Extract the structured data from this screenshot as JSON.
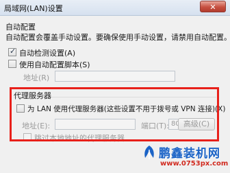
{
  "window": {
    "title": "局域网(LAN)设置",
    "close_label": "✕"
  },
  "auto_config": {
    "group_title": "自动配置",
    "description": "自动配置会覆盖手动设置。要确保使用手动设置，请禁用自动配置。",
    "auto_detect_label": "自动检测设置(A)",
    "auto_detect_checked": true,
    "use_script_label": "使用自动配置脚本(S)",
    "use_script_checked": false,
    "address_label": "地址(R)",
    "address_value": ""
  },
  "proxy": {
    "group_title": "代理服务器",
    "use_proxy_label": "为 LAN 使用代理服务器(这些设置不用于拨号或 VPN 连接)(X)",
    "use_proxy_checked": false,
    "address_label": "地址(E):",
    "address_value": "",
    "port_label": "端口(T):",
    "port_value": "80",
    "advanced_label": "高级(C)",
    "bypass_label": "跳过本地地址的代理服务器"
  },
  "watermark": {
    "brand": "鹏鑫装机网",
    "url": "www.0753px.com"
  }
}
